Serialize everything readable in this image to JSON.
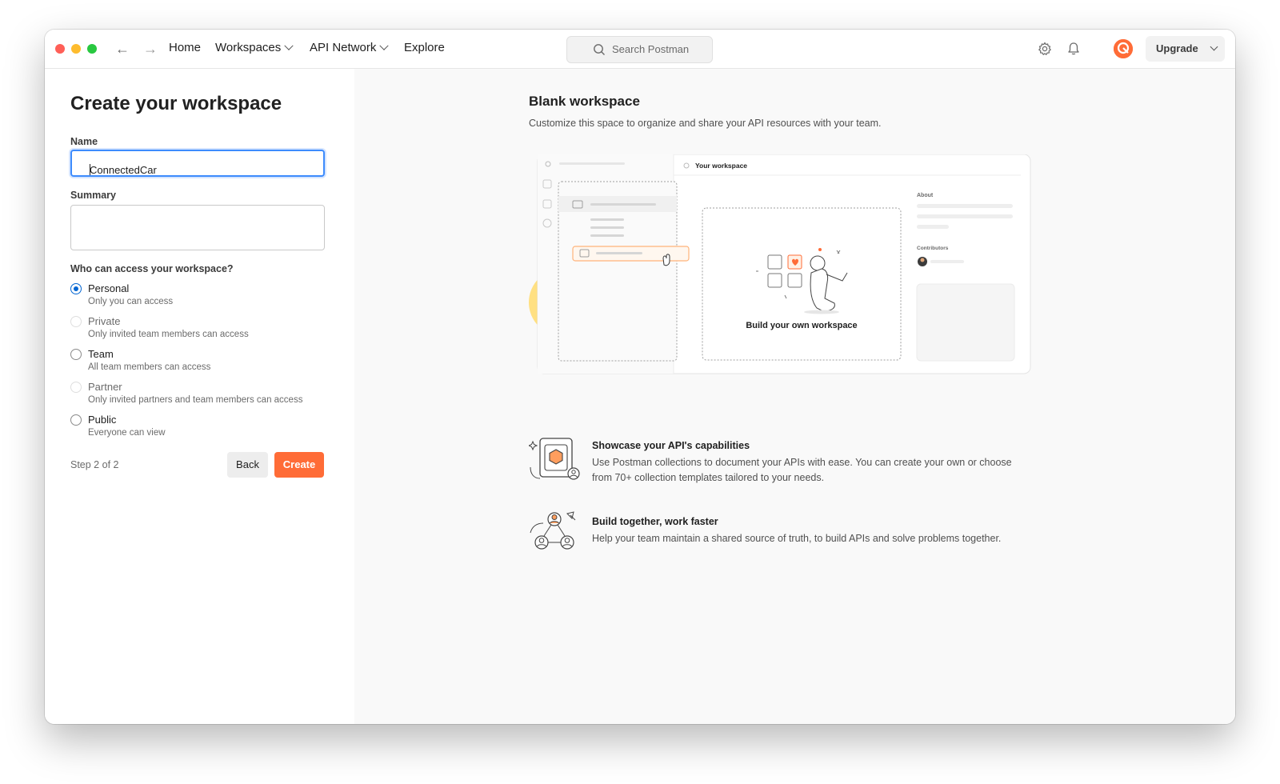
{
  "nav": {
    "home": "Home",
    "workspaces": "Workspaces",
    "api_network": "API Network",
    "explore": "Explore",
    "search_placeholder": "Search Postman",
    "upgrade": "Upgrade"
  },
  "form": {
    "title": "Create your workspace",
    "name_label": "Name",
    "name_value": "ConnectedCar",
    "summary_label": "Summary",
    "access_question": "Who can access your workspace?",
    "options": [
      {
        "label": "Personal",
        "desc": "Only you can access",
        "checked": true,
        "disabled": false
      },
      {
        "label": "Private",
        "desc": "Only invited team members can access",
        "checked": false,
        "disabled": true
      },
      {
        "label": "Team",
        "desc": "All team members can access",
        "checked": false,
        "disabled": false
      },
      {
        "label": "Partner",
        "desc": "Only invited partners and team members can access",
        "checked": false,
        "disabled": true
      },
      {
        "label": "Public",
        "desc": "Everyone can view",
        "checked": false,
        "disabled": false
      }
    ],
    "step": "Step 2 of 2",
    "back": "Back",
    "create": "Create"
  },
  "preview": {
    "title": "Blank workspace",
    "subtitle": "Customize this space to organize and share your API resources with your team.",
    "illustration": {
      "header": "Your workspace",
      "about": "About",
      "contributors": "Contributors",
      "caption": "Build your own workspace"
    },
    "features": [
      {
        "title": "Showcase your API's capabilities",
        "desc": "Use Postman collections to document your APIs with ease. You can create your own or choose from 70+ collection templates tailored to your needs."
      },
      {
        "title": "Build together, work faster",
        "desc": "Help your team maintain a shared source of truth, to build APIs and solve problems together."
      }
    ]
  },
  "colors": {
    "brand_orange": "#ff6c37",
    "focus_blue": "#3d8bfd",
    "radio_blue": "#0265d2"
  }
}
